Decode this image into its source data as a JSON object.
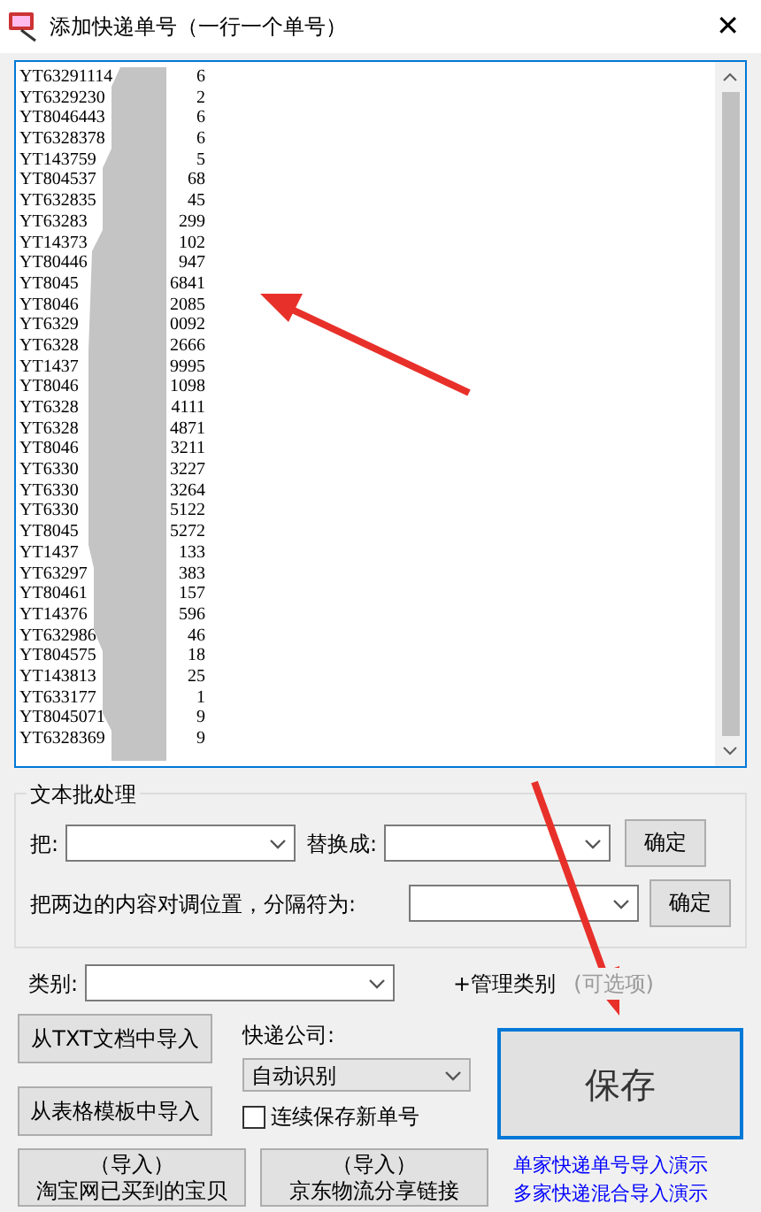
{
  "window": {
    "title": "添加快递单号（一行一个单号）",
    "close": "✕"
  },
  "tracking_lines": [
    {
      "start": "YT63291114",
      "end": "6"
    },
    {
      "start": "YT6329230",
      "end": "2"
    },
    {
      "start": "YT8046443",
      "end": "6"
    },
    {
      "start": "YT6328378",
      "end": "6"
    },
    {
      "start": "YT143759",
      "end": "5"
    },
    {
      "start": "YT804537",
      "end": "68"
    },
    {
      "start": "YT632835",
      "end": "45"
    },
    {
      "start": "YT63283",
      "end": "299"
    },
    {
      "start": "YT14373",
      "end": "102"
    },
    {
      "start": "YT80446",
      "end": "947"
    },
    {
      "start": "YT8045",
      "end": "6841"
    },
    {
      "start": "YT8046",
      "end": "2085"
    },
    {
      "start": "YT6329",
      "end": "0092"
    },
    {
      "start": "YT6328",
      "end": "2666"
    },
    {
      "start": "YT1437",
      "end": "9995"
    },
    {
      "start": "YT8046",
      "end": "1098"
    },
    {
      "start": "YT6328",
      "end": "4111"
    },
    {
      "start": "YT6328",
      "end": "4871"
    },
    {
      "start": "YT8046",
      "end": "3211"
    },
    {
      "start": "YT6330",
      "end": "3227"
    },
    {
      "start": "YT6330",
      "end": "3264"
    },
    {
      "start": "YT6330",
      "end": "5122"
    },
    {
      "start": "YT8045",
      "end": "5272"
    },
    {
      "start": "YT1437",
      "end": "133"
    },
    {
      "start": "YT63297",
      "end": "383"
    },
    {
      "start": "YT80461",
      "end": "157"
    },
    {
      "start": "YT14376",
      "end": "596"
    },
    {
      "start": "YT632986",
      "end": "46"
    },
    {
      "start": "YT804575",
      "end": "18"
    },
    {
      "start": "YT143813",
      "end": "25"
    },
    {
      "start": "YT633177",
      "end": "1"
    },
    {
      "start": "YT8045071",
      "end": "9"
    },
    {
      "start": "YT6328369",
      "end": "9"
    }
  ],
  "batch": {
    "legend": "文本批处理",
    "replace_label": "把:",
    "replace_with_label": "替换成:",
    "swap_label": "把两边的内容对调位置，分隔符为:",
    "confirm_buttons": [
      "确定",
      "确定"
    ]
  },
  "category": {
    "label": "类别:",
    "manage": "+管理类别",
    "optional": "(可选项)"
  },
  "import_buttons": [
    "从TXT文档中导入",
    "从表格模板中导入"
  ],
  "courier": {
    "label": "快递公司:",
    "value": "自动识别"
  },
  "continuous_save": {
    "label": "连续保存新单号",
    "checked": false
  },
  "save_button": "保存",
  "links": [
    "单家快递单号导入演示",
    "多家快递混合导入演示"
  ],
  "bottom_buttons": [
    {
      "line1": "（导入）",
      "line2": "淘宝网已买到的宝贝"
    },
    {
      "line1": "（导入）",
      "line2": "京东物流分享链接"
    }
  ]
}
